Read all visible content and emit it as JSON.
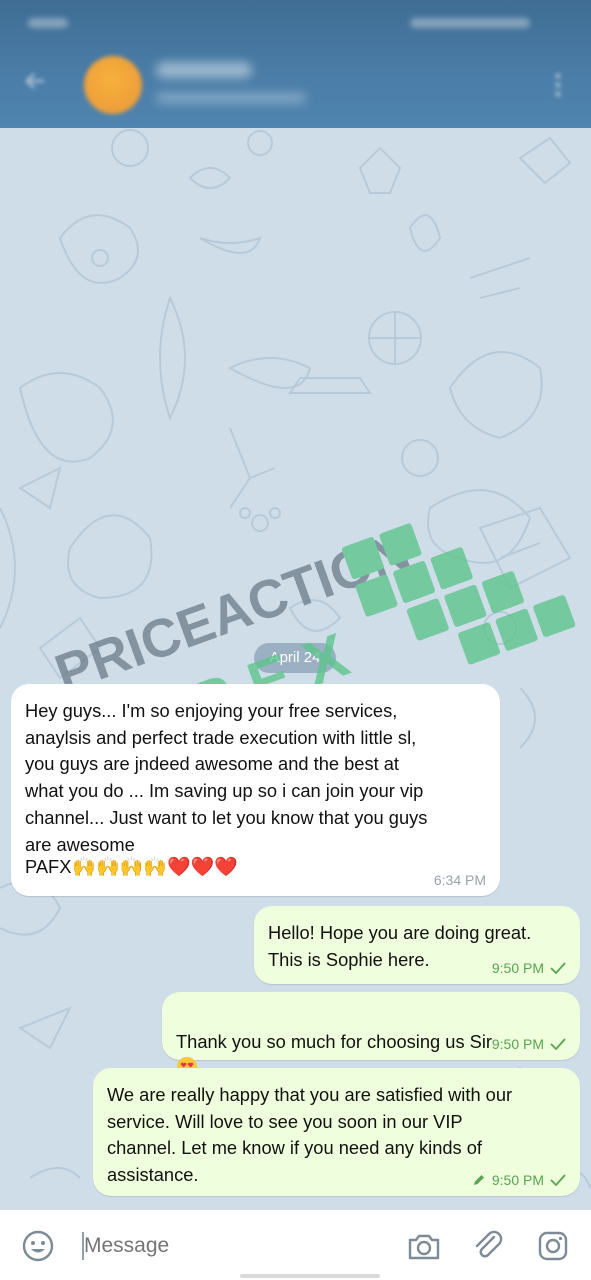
{
  "header": {
    "contact_name": "",
    "contact_status": ""
  },
  "chat": {
    "date_separator": "April 24",
    "messages": [
      {
        "direction": "incoming",
        "text": "Hey guys... I'm so enjoying your free services,\nanaylsis and perfect trade execution with little sl,\nyou guys are jndeed awesome and the best at\nwhat you do ... Im saving up so i can join your vip\nchannel... Just want to let you know that you guys\nare awesome",
        "signoff": "PAFX",
        "emojis": "🙌🙌🙌🙌❤️❤️❤️",
        "time": "6:34 PM"
      },
      {
        "direction": "outgoing",
        "text": "Hello! Hope you are doing great.\nThis is Sophie here.",
        "time": "9:50 PM",
        "status": "sent-check"
      },
      {
        "direction": "outgoing",
        "text": "Thank you so much for choosing us Sir",
        "emoji_icon": "heart-eyes-emoji",
        "time": "9:50 PM",
        "status": "sent-check"
      },
      {
        "direction": "outgoing",
        "text": "We are really happy that you are satisfied with our\nservice. Will love to see you soon in our VIP\nchannel. Let me know if you need any kinds of\nassistance.",
        "time": "9:50 PM",
        "edited": true,
        "status": "sent-check"
      }
    ]
  },
  "watermark": {
    "line1": "PRICEACTION",
    "line2": "FOREX"
  },
  "composer": {
    "placeholder": "Message",
    "icons": [
      "emoji-icon",
      "camera-icon",
      "attach-icon",
      "instagram-icon"
    ]
  },
  "colors": {
    "header": "#4a7ca6",
    "chat_background": "#cfdde9",
    "incoming_bubble": "#ffffff",
    "outgoing_bubble": "#effedd",
    "outgoing_time": "#57a551",
    "watermark_text": "#6e7f8c",
    "watermark_accent": "#5cc48b"
  }
}
